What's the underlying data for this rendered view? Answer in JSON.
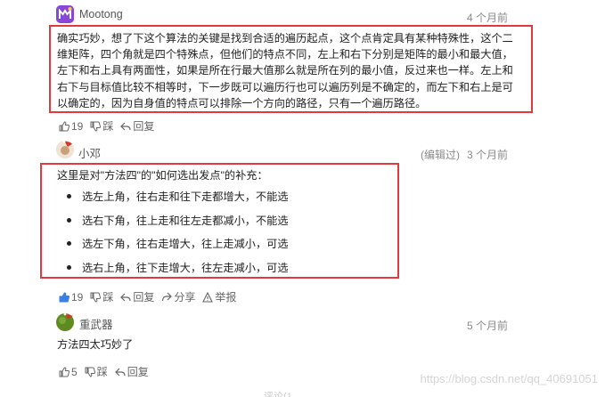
{
  "comments": [
    {
      "username": "Mootong",
      "time": "4 个月前",
      "body": "确实巧妙，想了下这个算法的关键是找到合适的遍历起点，这个点肯定具有某种特殊性，这个二维矩阵，四个角就是四个特殊点，但他们的特点不同，左上和右下分别是矩阵的最小和最大值，左下和右上具有两面性，如果是所在行最大值那么就是所在列的最小值，反过来也一样。左上和右下与目标值比较不相等时，下一步既可以遍历行也可以遍历列是不确定的，而左下和右上是可以确定的，因为自身值的特点可以排除一个方向的路径，只有一个遍历路径。",
      "likes": "19",
      "dislike_label": "踩",
      "reply_label": "回复"
    },
    {
      "username": "小邓",
      "edited": "(编辑过)",
      "time": "3 个月前",
      "intro": "这里是对\"方法四\"的\"如何选出发点\"的补充：",
      "items": [
        "选左上角，往右走和往下走都增大，不能选",
        "选右下角，往上走和往左走都减小，不能选",
        "选左下角，往右走增大，往上走减小，可选",
        "选右上角，往下走增大，往左走减小，可选"
      ],
      "likes": "19",
      "dislike_label": "踩",
      "reply_label": "回复",
      "share_label": "分享",
      "report_label": "举报"
    },
    {
      "username": "重武器",
      "time": "5 个月前",
      "body": "方法四太巧妙了",
      "likes": "5",
      "dislike_label": "踩",
      "reply_label": "回复"
    }
  ],
  "footer_hint": "评论(1",
  "watermark": "https://blog.csdn.net/qq_40691051",
  "colors": {
    "highlight_box": "#e0393e",
    "like_active": "#3b7fe0"
  }
}
